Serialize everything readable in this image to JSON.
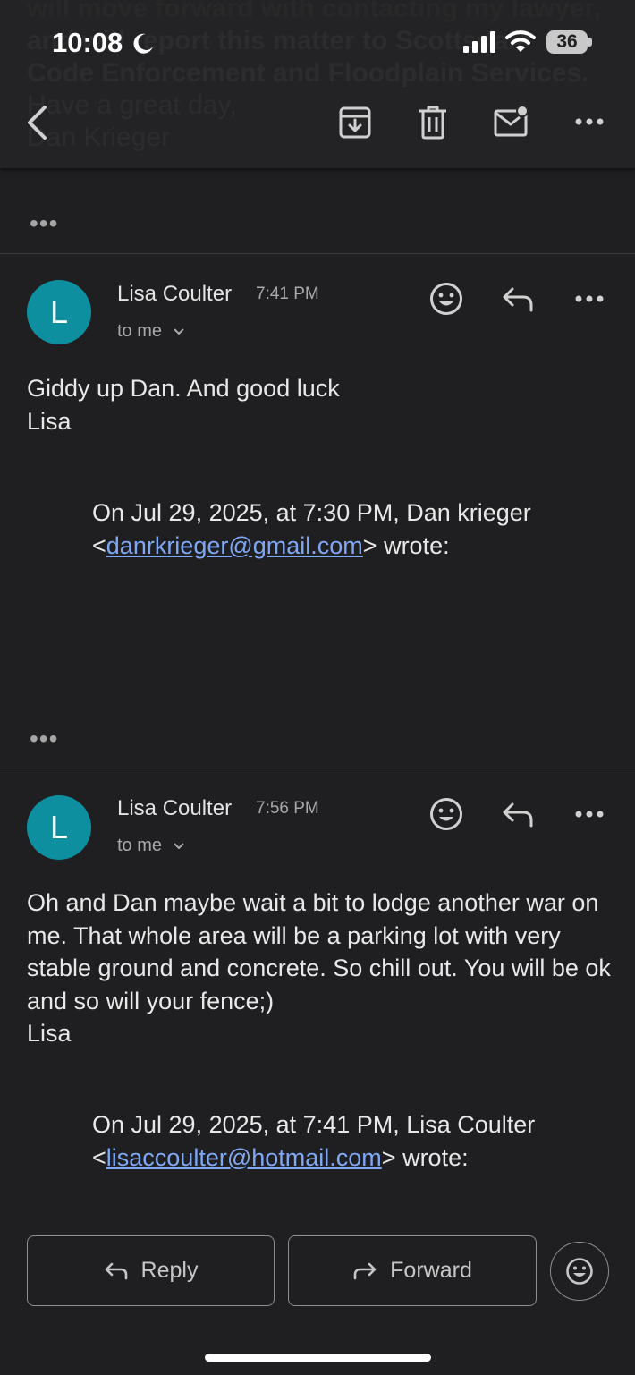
{
  "status_bar": {
    "time": "10:08",
    "battery": "36"
  },
  "background_text": {
    "line1": "will move forward with contacting my lawyer,",
    "line2": "and will report this matter to Scottsdale",
    "line3": "Code Enforcement and Floodplain Services.",
    "line4": "Have a great day,",
    "line5": "Dan Krieger"
  },
  "toolbar": {
    "icons": [
      "back-arrow-icon",
      "archive-icon",
      "trash-icon",
      "mark-unread-icon",
      "more-icon"
    ]
  },
  "collapsed_indicator": "•••",
  "messages": [
    {
      "avatar_letter": "L",
      "sender": "Lisa Coulter",
      "time": "7:41 PM",
      "recipient": "to me",
      "body_line1": "Giddy up Dan. And good luck",
      "body_line2": "Lisa",
      "quote_prefix": "On Jul 29, 2025, at 7:30 PM, Dan krieger <",
      "quote_email": "danrkrieger@gmail.com",
      "quote_suffix": "> wrote:"
    },
    {
      "avatar_letter": "L",
      "sender": "Lisa Coulter",
      "time": "7:56 PM",
      "recipient": "to me",
      "body_line1": "Oh and Dan maybe wait a bit to lodge another war on me. That whole area will be a parking lot with very stable ground and concrete. So chill out. You will be ok and so will your fence;)",
      "body_line2": "Lisa",
      "quote_prefix": "On Jul 29, 2025, at 7:41 PM, Lisa Coulter <",
      "quote_email": "lisaccoulter@hotmail.com",
      "quote_suffix": "> wrote:"
    }
  ],
  "actions": {
    "reply": "Reply",
    "forward": "Forward"
  },
  "colors": {
    "background": "#1f1f21",
    "avatar": "#0e8fa0",
    "link": "#7fa8f4"
  }
}
